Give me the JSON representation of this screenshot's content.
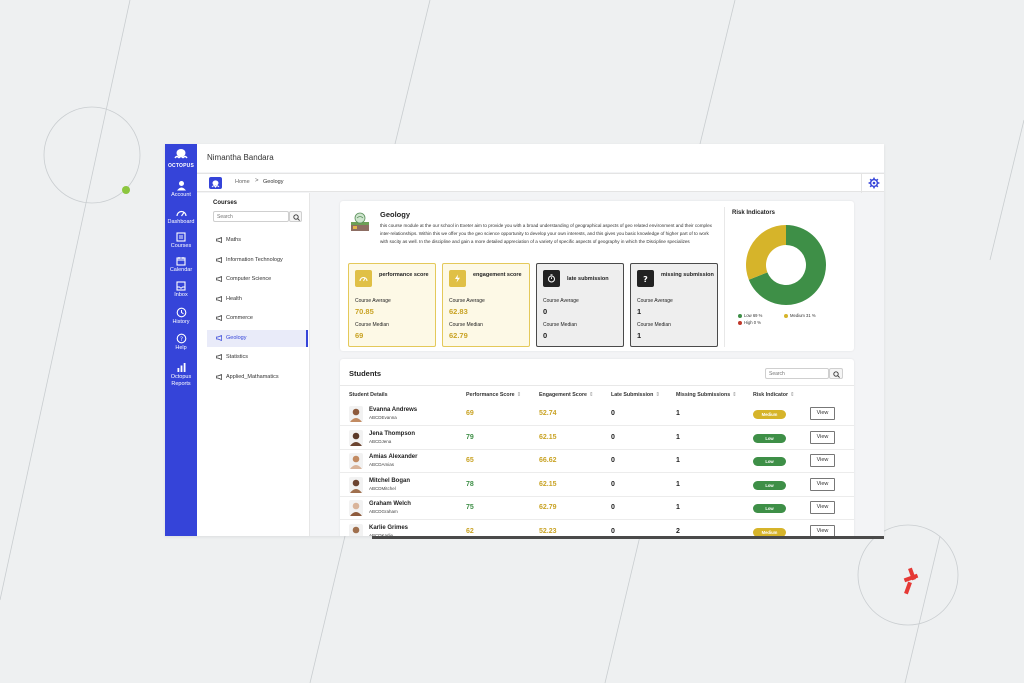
{
  "app": {
    "logo_text": "OCTOPUS",
    "user_name": "Nimantha Bandara"
  },
  "rail": {
    "items": [
      {
        "label": "Account",
        "icon": "account-icon"
      },
      {
        "label": "Dashboard",
        "icon": "dashboard-icon"
      },
      {
        "label": "Courses",
        "icon": "courses-icon"
      },
      {
        "label": "Calendar",
        "icon": "calendar-icon"
      },
      {
        "label": "Inbox",
        "icon": "inbox-icon"
      },
      {
        "label": "History",
        "icon": "history-icon"
      },
      {
        "label": "Help",
        "icon": "help-icon"
      },
      {
        "label": "Octopus Reports",
        "icon": "reports-icon"
      }
    ]
  },
  "breadcrumb": {
    "home": "Home",
    "separator": ">",
    "current": "Geology"
  },
  "sidebar": {
    "title": "Courses",
    "search_placeholder": "Search",
    "courses": [
      "Maths",
      "Information Technology",
      "Computer Science",
      "Health",
      "Commerce",
      "Geology",
      "Statistics",
      "Applied_Mathamatics"
    ],
    "active_index": 5
  },
  "course": {
    "name": "Geology",
    "description": "this course module at the our school in Exeter aim to provide you with a broad understanding of geographical aspects of geo related environment and their complex inter-relationships. Within this we offer you the geo science opportunity to develop your own interests, and this gives you basic knowledge of higher part of to work with socity as well. In the discipline and gain a more detailed appreciation of a variety of specific aspects of geography in which the Discipline specializes"
  },
  "stats": [
    {
      "title": "performance score",
      "avg_label": "Course Average",
      "avg": "70.85",
      "med_label": "Course Median",
      "med": "69",
      "style": "gold"
    },
    {
      "title": "engagement score",
      "avg_label": "Course Average",
      "avg": "62.83",
      "med_label": "Course Median",
      "med": "62.79",
      "style": "gold"
    },
    {
      "title": "late submission",
      "avg_label": "Course Average",
      "avg": "0",
      "med_label": "Course Median",
      "med": "0",
      "style": "gray"
    },
    {
      "title": "missing submission",
      "avg_label": "Course Average",
      "avg": "1",
      "med_label": "Course Median",
      "med": "1",
      "style": "gray"
    }
  ],
  "risk": {
    "title": "Risk Indicators",
    "segments": [
      {
        "label": "Low 69 %",
        "value": 69,
        "color": "#3e8f47"
      },
      {
        "label": "Medium 31 %",
        "value": 31,
        "color": "#d6b42a"
      },
      {
        "label": "High 0 %",
        "value": 0,
        "color": "#c0392b"
      }
    ]
  },
  "students": {
    "title": "Students",
    "search_placeholder": "Search",
    "columns": [
      "Student Details",
      "Performance Score",
      "Engagement Score",
      "Late Submission",
      "Missing Submissions",
      "Risk Indicator"
    ],
    "rows": [
      {
        "name": "Evanna Andrews",
        "id": "ABCDEvanna",
        "perf": "69",
        "eng": "52.74",
        "late": "0",
        "missing": "1",
        "risk": "Medium"
      },
      {
        "name": "Jena Thompson",
        "id": "ABCDJena",
        "perf": "79",
        "eng": "62.15",
        "late": "0",
        "missing": "1",
        "risk": "Low"
      },
      {
        "name": "Amias Alexander",
        "id": "ABCDAmias",
        "perf": "65",
        "eng": "66.62",
        "late": "0",
        "missing": "1",
        "risk": "Low"
      },
      {
        "name": "Mitchel Bogan",
        "id": "ABCDMitchel",
        "perf": "78",
        "eng": "62.15",
        "late": "0",
        "missing": "1",
        "risk": "Low"
      },
      {
        "name": "Graham Welch",
        "id": "ABCDGraham",
        "perf": "75",
        "eng": "62.79",
        "late": "0",
        "missing": "1",
        "risk": "Low"
      },
      {
        "name": "Karlie Grimes",
        "id": "ABCDKarlie",
        "perf": "62",
        "eng": "52.23",
        "late": "0",
        "missing": "2",
        "risk": "Medium"
      }
    ],
    "view_label": "View"
  }
}
